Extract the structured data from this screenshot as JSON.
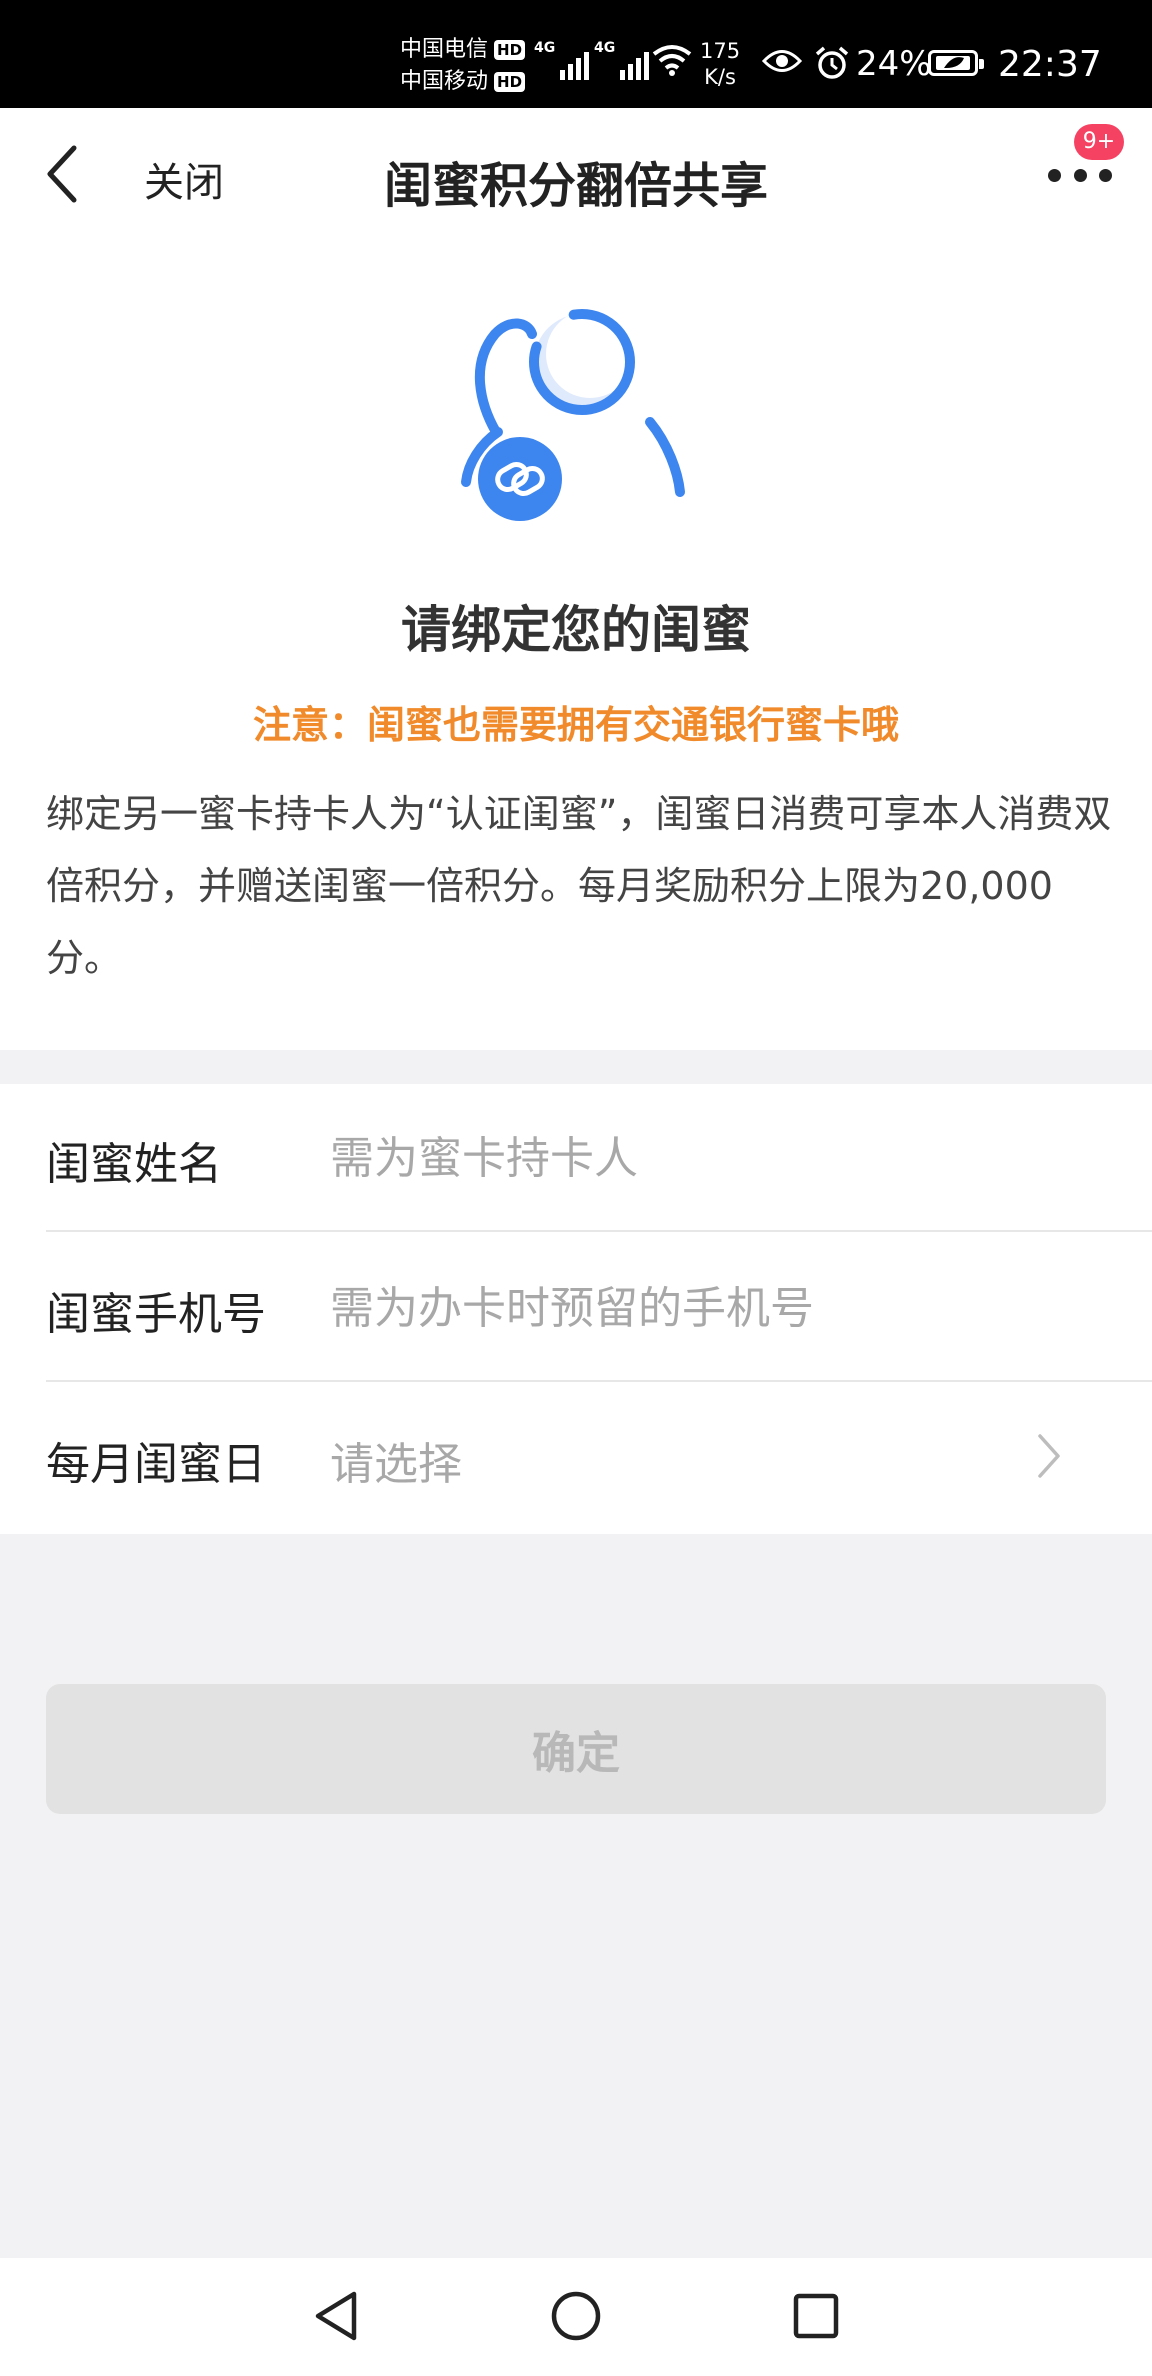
{
  "status_bar": {
    "carrier_1": "中国电信",
    "carrier_2": "中国移动",
    "hd_label": "HD",
    "network_type": "4G",
    "net_speed_value": "175",
    "net_speed_unit": "K/s",
    "battery_percent": "24%",
    "time": "22:37"
  },
  "header": {
    "close_label": "关闭",
    "title": "闺蜜积分翻倍共享",
    "badge_count": "9+"
  },
  "intro": {
    "title": "请绑定您的闺蜜",
    "notice": "注意：闺蜜也需要拥有交通银行蜜卡哦",
    "description": "绑定另一蜜卡持卡人为“认证闺蜜”，闺蜜日消费可享本人消费双倍积分，并赠送闺蜜一倍积分。每月奖励积分上限为20,000分。"
  },
  "form": {
    "name_label": "闺蜜姓名",
    "name_placeholder": "需为蜜卡持卡人",
    "phone_label": "闺蜜手机号",
    "phone_placeholder": "需为办卡时预留的手机号",
    "day_label": "每月闺蜜日",
    "day_value": "请选择"
  },
  "confirm_label": "确定",
  "colors": {
    "accent_blue": "#3e86ef",
    "notice_orange": "#f08a2a",
    "badge_red": "#f64262",
    "disabled_button": "#e2e2e2"
  }
}
